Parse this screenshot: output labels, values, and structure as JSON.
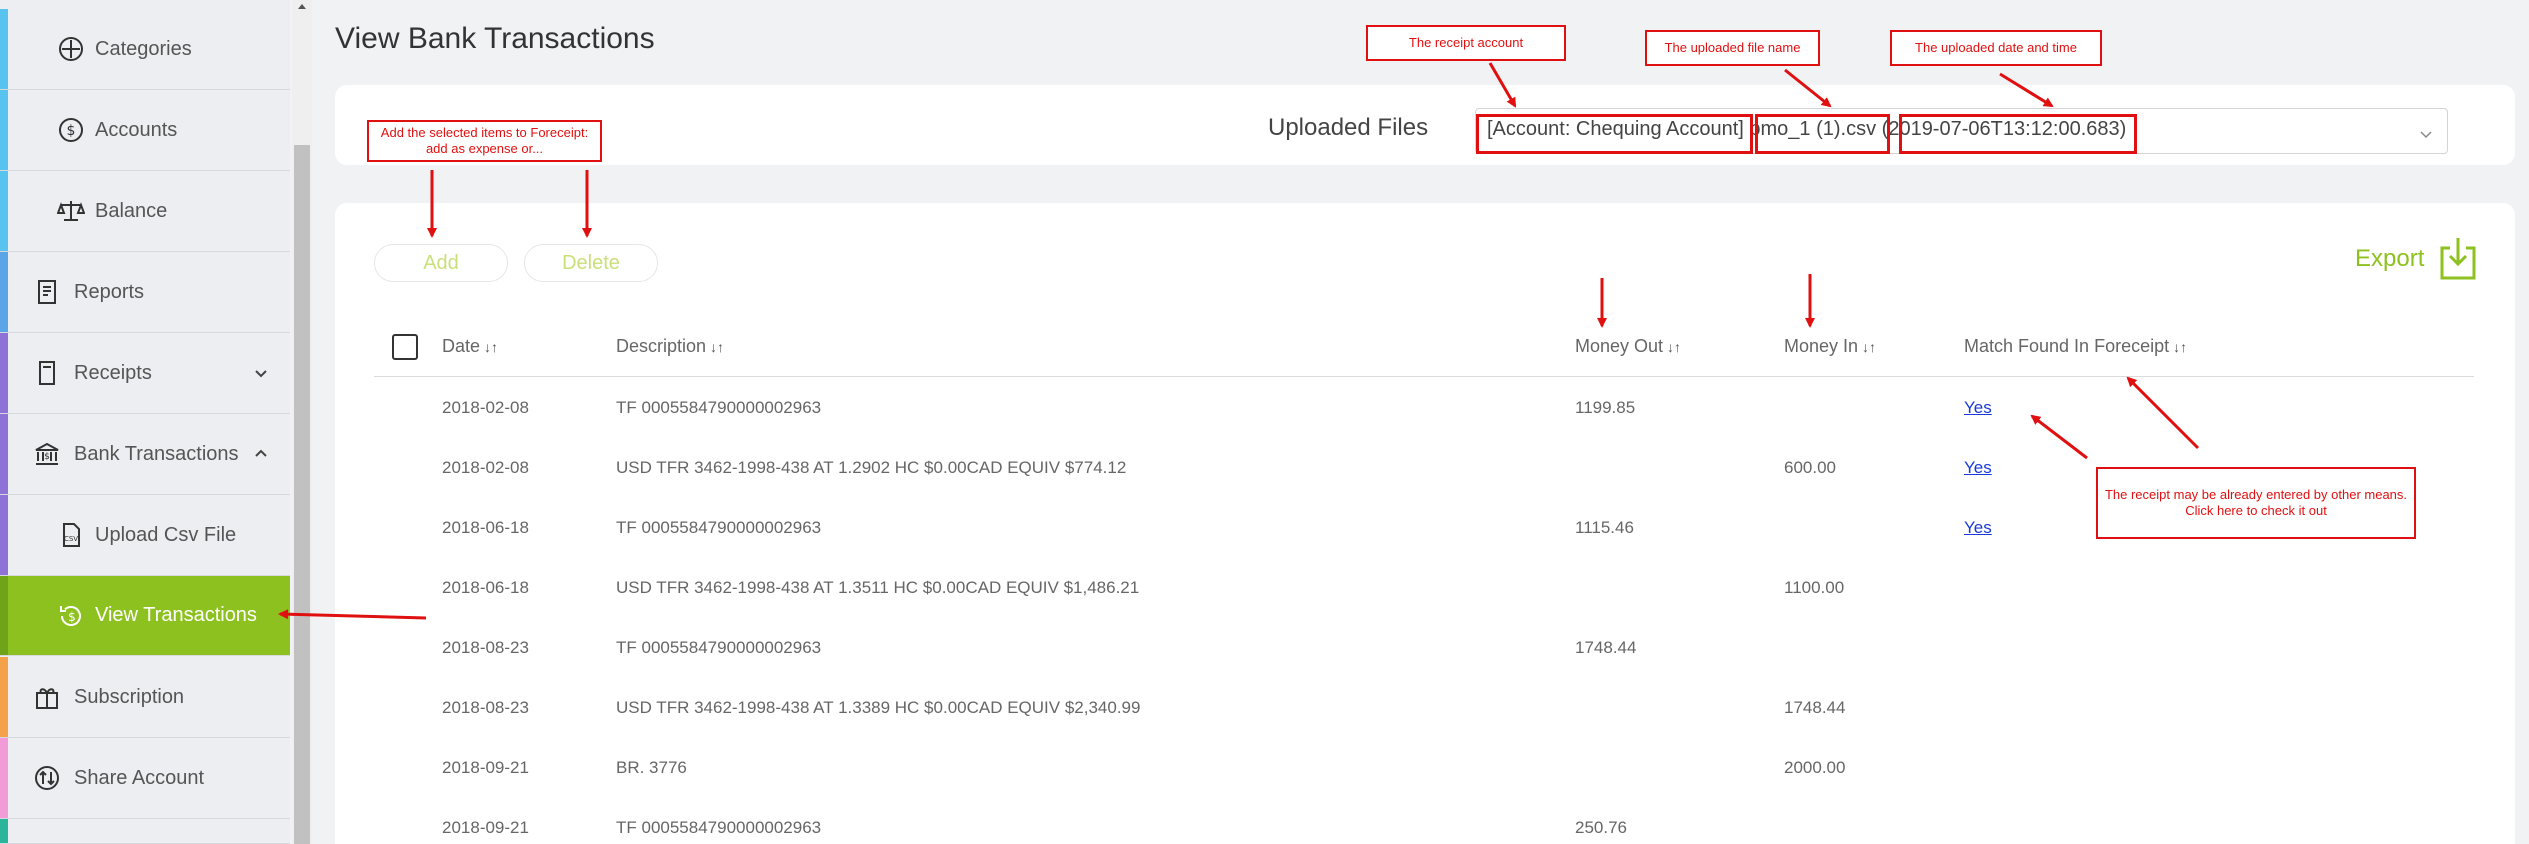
{
  "sidebar": {
    "items": [
      {
        "label": "Categories",
        "icon": "category-icon",
        "strip": "#58c3ee"
      },
      {
        "label": "Accounts",
        "icon": "dollar-circle-icon",
        "strip": "#58c3ee"
      },
      {
        "label": "Balance",
        "icon": "balance-scale-icon",
        "strip": "#58c3ee"
      },
      {
        "label": "Reports",
        "icon": "report-icon",
        "strip": "#5aa5e8"
      },
      {
        "label": "Receipts",
        "icon": "receipt-icon",
        "strip": "#8e72d8"
      },
      {
        "label": "Bank Transactions",
        "icon": "bank-icon",
        "strip": "#8e72d8"
      },
      {
        "label": "Upload Csv File",
        "icon": "csv-file-icon",
        "strip": "#8e72d8"
      },
      {
        "label": "View Transactions",
        "icon": "dollar-refresh-icon",
        "strip": "#6fa31a"
      },
      {
        "label": "Subscription",
        "icon": "gift-icon",
        "strip": "#f4a14a"
      },
      {
        "label": "Share Account",
        "icon": "share-icon",
        "strip": "#f29bd8"
      }
    ],
    "active_color": "#8dc11f"
  },
  "page_title": "View Bank Transactions",
  "uploaded_files": {
    "label": "Uploaded Files",
    "selected": "[Account: Chequing Account] bmo_1 (1).csv (2019-07-06T13:12:00.683)"
  },
  "actions": {
    "add_label": "Add",
    "delete_label": "Delete",
    "export_label": "Export"
  },
  "table": {
    "columns": [
      {
        "label": "Date"
      },
      {
        "label": "Description"
      },
      {
        "label": "Money Out"
      },
      {
        "label": "Money In"
      },
      {
        "label": "Match Found In Foreceipt"
      }
    ],
    "rows": [
      {
        "date": "2018-02-08",
        "description": "TF 0005584790000002963",
        "money_out": "1199.85",
        "money_in": "",
        "match": "Yes"
      },
      {
        "date": "2018-02-08",
        "description": "USD TFR 3462-1998-438 AT 1.2902 HC $0.00CAD EQUIV $774.12",
        "money_out": "",
        "money_in": "600.00",
        "match": "Yes"
      },
      {
        "date": "2018-06-18",
        "description": "TF 0005584790000002963",
        "money_out": "1115.46",
        "money_in": "",
        "match": "Yes"
      },
      {
        "date": "2018-06-18",
        "description": "USD TFR 3462-1998-438 AT 1.3511 HC $0.00CAD EQUIV $1,486.21",
        "money_out": "",
        "money_in": "1100.00",
        "match": ""
      },
      {
        "date": "2018-08-23",
        "description": "TF 0005584790000002963",
        "money_out": "1748.44",
        "money_in": "",
        "match": ""
      },
      {
        "date": "2018-08-23",
        "description": "USD TFR 3462-1998-438 AT 1.3389 HC $0.00CAD EQUIV $2,340.99",
        "money_out": "",
        "money_in": "1748.44",
        "match": ""
      },
      {
        "date": "2018-09-21",
        "description": "BR. 3776",
        "money_out": "",
        "money_in": "2000.00",
        "match": ""
      },
      {
        "date": "2018-09-21",
        "description": "TF 0005584790000002963",
        "money_out": "250.76",
        "money_in": "",
        "match": ""
      }
    ]
  },
  "annotations": {
    "receipt_account": "The receipt account",
    "file_name": "The uploaded file name",
    "date_time": "The uploaded date and time",
    "add_hint": "Add the selected items to Foreceipt: add as expense or...",
    "match_hint": "The receipt may be already entered by other means. Click here to check it out"
  },
  "colors": {
    "accent": "#8dc11f",
    "annotation": "#e01010",
    "link": "#1a3ad8"
  }
}
